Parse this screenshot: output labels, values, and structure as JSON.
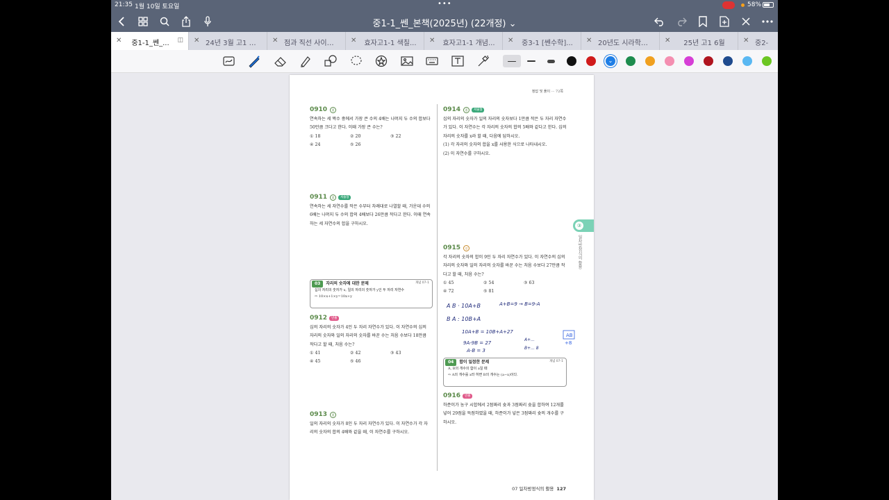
{
  "status": {
    "time": "21:35",
    "date": "1월 10일 토요일",
    "battery": "58%"
  },
  "nav": {
    "title": "중1-1_쎈_본책(2025년) (22개정)"
  },
  "tabs": [
    {
      "label": "중1-1_쎈_..."
    },
    {
      "label": "24년 3월 고1 전..."
    },
    {
      "label": "점과 직선 사이의..."
    },
    {
      "label": "효자고1-1 색칠..."
    },
    {
      "label": "효자고1-1 개념..."
    },
    {
      "label": "중3-1 [쎈수학]..."
    },
    {
      "label": "20년도 시라학교..."
    },
    {
      "label": "25년 고1 6월"
    },
    {
      "label": "중2-"
    }
  ],
  "toolbar": {
    "colors": [
      "#111111",
      "#d01b1b",
      "#1e7ee6",
      "#1e8c4e",
      "#f0a020",
      "#f48fb1",
      "#d63fd6",
      "#b0151f",
      "#1f4b8e",
      "#5ab8f2",
      "#6cc623"
    ],
    "icons": [
      "lasso-ocr-icon",
      "pen-icon",
      "eraser-icon",
      "highlighter-icon",
      "shapes-icon",
      "lasso-icon",
      "sticker-icon",
      "image-icon",
      "keyboard-icon",
      "textbox-icon",
      "laser-pointer-icon"
    ]
  },
  "page": {
    "header": "정답 및 풀이 ··· 72쪽",
    "footer_section": "07 일차방정식의 활용",
    "footer_page": "127",
    "side_number": "③",
    "side_text": "일차방정식의 활용",
    "p0910": {
      "num": "0910",
      "text": "연속하는 세 짝수 중에서 가장 큰 수의 4배는 나머지 두 수의 합보다 50만큼 크다고 한다. 이때 가장 큰 수는?",
      "choices": [
        "① 18",
        "② 20",
        "③ 22",
        "④ 24",
        "⑤ 26"
      ]
    },
    "p0911": {
      "num": "0911",
      "tag": "서술형",
      "text": "연속하는 세 자연수를 작은 수부터 차례대로 나열할 때, 가운데 수의 6배는 나머지 두 수의 합의 4배보다 26만큼 작다고 한다. 이때 연속하는 세 자연수의 합을 구하시오."
    },
    "box03": {
      "badge": "03",
      "title": "자리의 숫자에 대한 문제",
      "ref": "개념 07-1",
      "line1": "십의 자리의 숫자가 x, 일의 자리의 숫자가 y인 두 자리 자연수",
      "line2": "⇨ 10×x+1×y=10x+y"
    },
    "p0912": {
      "num": "0912",
      "tag": "빈출",
      "text": "십의 자리의 숫자가 4인 두 자리 자연수가 있다. 이 자연수의 십의 자리의 숫자와 일의 자리의 숫자를 바꾼 수는 처음 수보다 18만큼 작다고 할 때, 처음 수는?",
      "choices": [
        "① 41",
        "② 42",
        "③ 43",
        "④ 45",
        "⑤ 46"
      ]
    },
    "p0913": {
      "num": "0913",
      "text": "일의 자리의 숫자가 8인 두 자리 자연수가 있다. 이 자연수가 각 자리의 숫자의 합의 4배와 같을 때, 이 자연수를 구하시오."
    },
    "p0914": {
      "num": "0914",
      "tag": "서술형",
      "text": "십의 자리의 숫자가 일의 자리의 숫자보다 1만큼 작은 두 자리 자연수가 있다. 이 자연수는 각 자리의 숫자의 합의 5배와 같다고 한다. 십의 자리의 숫자를 x라 할 때, 다음에 답하시오.",
      "sub1": "(1) 각 자리의 숫자의 합을 x를 사용한 식으로 나타내시오.",
      "sub2": "(2) 이 자연수를 구하시오."
    },
    "p0915": {
      "num": "0915",
      "text": "각 자리의 숫자의 합이 9인 두 자리 자연수가 있다. 이 자연수의 십의 자리의 숫자와 일의 자리의 숫자를 바꾼 수는 처음 수보다 27만큼 작다고 할 때, 처음 수는?",
      "choices": [
        "① 45",
        "② 54",
        "③ 63",
        "④ 72",
        "⑤ 81"
      ]
    },
    "box04": {
      "badge": "04",
      "title": "합이 일정한 문제",
      "ref": "개념 07-1",
      "line1": "A, B의 개수의 합이 a일 때",
      "line2": "⇨ A의 개수를 x라 하면 B의 개수는 (a−x)이다."
    },
    "p0916": {
      "num": "0916",
      "tag": "빈출",
      "text": "하준이가 농구 시합에서 2점짜리 슛과 3점짜리 슛을 합하여 12개를 넣어 29점을 득점하였을 때, 하준이가 넣은 3점짜리 슛의 개수를 구하시오."
    },
    "handwriting": [
      "A B · 10A+B",
      "A+B=9 → B=9-A",
      "B A : 10B+A",
      "10A+B = 10B+A+27",
      "9A-9B = 27",
      "A-B = 3",
      "A+...",
      "B+... 8"
    ]
  }
}
